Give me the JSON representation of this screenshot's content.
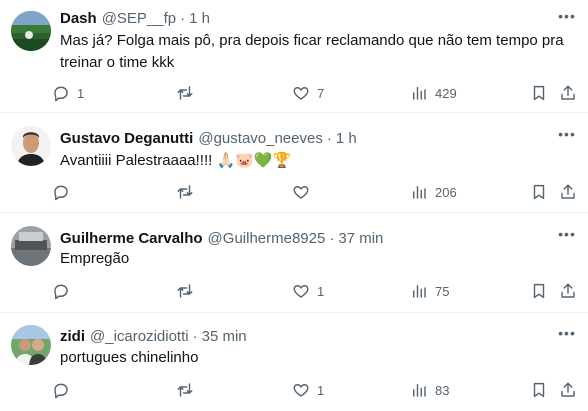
{
  "colors": {
    "text": "#0f1419",
    "secondary": "#536471",
    "divider": "#eff3f4"
  },
  "replies": [
    {
      "name": "Dash",
      "handle": "@SEP__fp",
      "separator": "·",
      "time": "1 h",
      "text": "Mas já? Folga mais pô, pra depois ficar reclamando que não tem tempo pra treinar o time kkk",
      "reply_count": "1",
      "retweet_count": "",
      "like_count": "7",
      "view_count": "429"
    },
    {
      "name": "Gustavo Deganutti",
      "handle": "@gustavo_neeves",
      "separator": "·",
      "time": "1 h",
      "text": "Avantiiii Palestraaaa!!!! 🙏🏻🐷💚🏆",
      "reply_count": "",
      "retweet_count": "",
      "like_count": "",
      "view_count": "206"
    },
    {
      "name": "Guilherme Carvalho",
      "handle": "@Guilherme8925",
      "separator": "·",
      "time": "37 min",
      "text": "Empregão",
      "reply_count": "",
      "retweet_count": "",
      "like_count": "1",
      "view_count": "75"
    },
    {
      "name": "zidi",
      "handle": "@_icarozidiotti",
      "separator": "·",
      "time": "35 min",
      "text": "portugues chinelinho",
      "reply_count": "",
      "retweet_count": "",
      "like_count": "1",
      "view_count": "83"
    }
  ]
}
